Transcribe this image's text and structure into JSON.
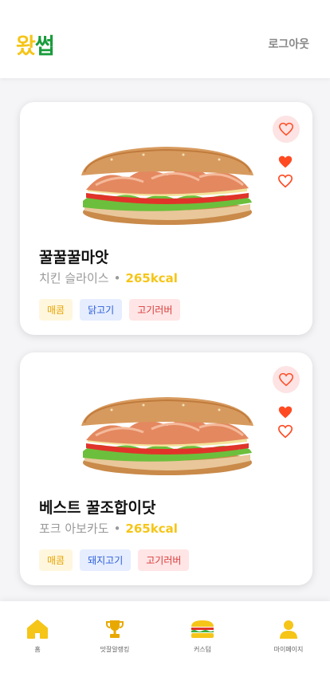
{
  "header": {
    "logo_part1": "왔",
    "logo_part2": "썹",
    "logout_label": "로그아웃"
  },
  "cards": [
    {
      "name": "꿀꿀꿀마앗",
      "base": "치킨 슬라이스",
      "separator": "•",
      "kcal": "265kcal",
      "tags": [
        "매콤",
        "닭고기",
        "고기러버"
      ]
    },
    {
      "name": "베스트 꿀조합이닷",
      "base": "포크 아보카도",
      "separator": "•",
      "kcal": "265kcal",
      "tags": [
        "매콤",
        "돼지고기",
        "고기러버"
      ]
    }
  ],
  "nav": {
    "home": "홈",
    "ranking": "맛잘알랭킹",
    "custom": "커스텀",
    "mypage": "마이페이지"
  },
  "colors": {
    "accent_yellow": "#f5c518",
    "accent_green": "#1a9c3c",
    "heart_red": "#ff4a22"
  },
  "icons": [
    "heart-icon",
    "heart-filled-icon",
    "home-icon",
    "trophy-icon",
    "sandwich-icon",
    "user-icon"
  ]
}
